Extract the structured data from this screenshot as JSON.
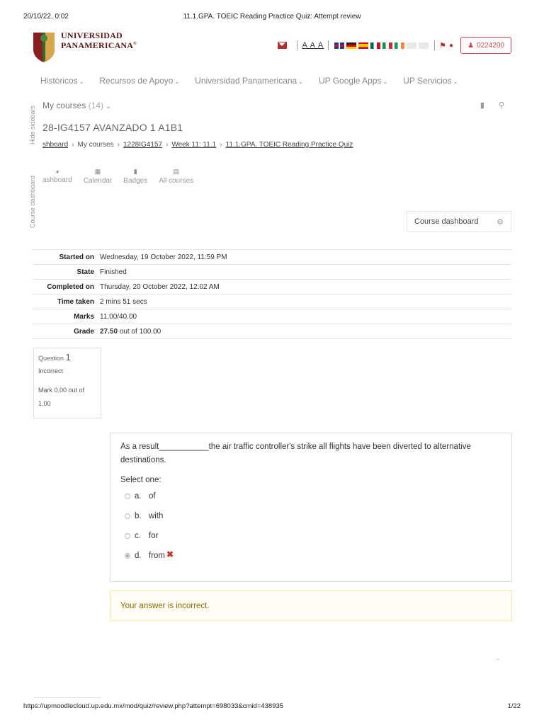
{
  "print": {
    "date": "20/10/22, 0:02",
    "title": "11.1.GPA. TOEIC Reading Practice Quiz: Attempt review",
    "url": "https://upmoodlecloud.up.edu.mx/mod/quiz/review.php?attempt=698033&cmid=438935",
    "page": "1/22"
  },
  "brand": {
    "line1": "UNIVERSIDAD",
    "line2": "PANAMERICANA",
    "reg": "®"
  },
  "toolbar": {
    "font_sizes": "A A A",
    "user_id": "0224200"
  },
  "nav": [
    {
      "label": "Históricos"
    },
    {
      "label": "Recursos de Apoyo"
    },
    {
      "label": "Universidad Panamericana"
    },
    {
      "label": "UP Google Apps"
    },
    {
      "label": "UP Servicios"
    }
  ],
  "sidebar": {
    "hide_label": "Hide sidebars",
    "course_dashboard_label": "Course dashboard"
  },
  "mycourses": {
    "label": "My courses",
    "count": "(14)"
  },
  "course": {
    "title": "28-IG4157 AVANZADO 1 A1B1"
  },
  "breadcrumb": {
    "items": [
      "shboard",
      "My courses",
      "1228IG4157",
      "Week 11: 11.1",
      "11.1.GPA. TOEIC Reading Practice Quiz"
    ]
  },
  "quicklinks": [
    {
      "label": "ashboard"
    },
    {
      "label": "Calendar"
    },
    {
      "label": "Badges"
    },
    {
      "label": "All courses"
    }
  ],
  "course_dashboard_button": "Course dashboard",
  "summary": {
    "rows": [
      {
        "label": "Started on",
        "value": "Wednesday, 19 October 2022, 11:59 PM"
      },
      {
        "label": "State",
        "value": "Finished"
      },
      {
        "label": "Completed on",
        "value": "Thursday, 20 October 2022, 12:02 AM"
      },
      {
        "label": "Time taken",
        "value": "2 mins 51 secs"
      },
      {
        "label": "Marks",
        "value": "11.00/40.00"
      }
    ],
    "grade_label": "Grade",
    "grade_value": "27.50",
    "grade_suffix": "out of 100.00"
  },
  "question": {
    "label": "Question",
    "number": "1",
    "state": "Incorrect",
    "mark": "Mark 0.00 out of 1.00",
    "text": "As a result___________the air traffic controller's strike all flights have been diverted to alternative destinations.",
    "select_one": "Select one:",
    "options": [
      {
        "letter": "a.",
        "text": "of",
        "checked": false
      },
      {
        "letter": "b.",
        "text": "with",
        "checked": false
      },
      {
        "letter": "c.",
        "text": "for",
        "checked": false
      },
      {
        "letter": "d.",
        "text": "from",
        "checked": true
      }
    ],
    "feedback": "Your answer is incorrect."
  }
}
